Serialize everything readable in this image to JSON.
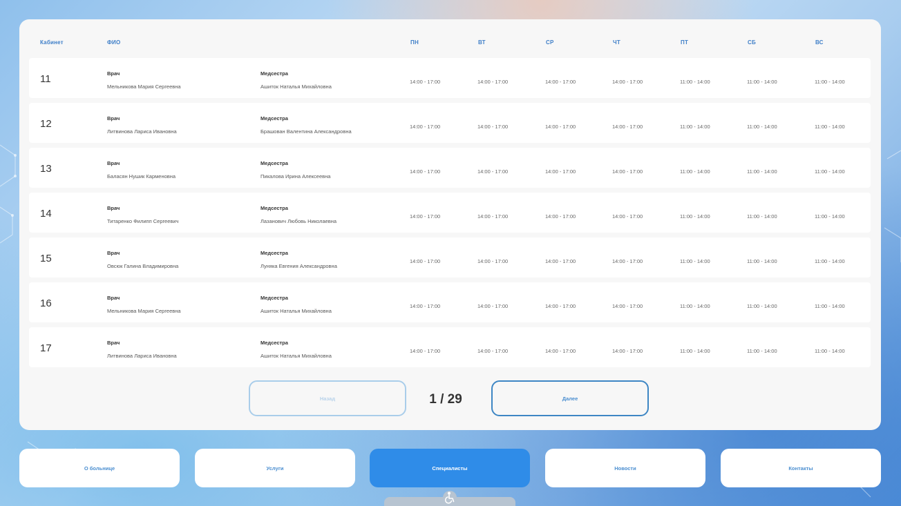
{
  "table": {
    "headers": {
      "cabinet": "Кабинет",
      "fio": "ФИО",
      "days": [
        "ПН",
        "ВТ",
        "СР",
        "ЧТ",
        "ПТ",
        "СБ",
        "ВС"
      ]
    },
    "rows": [
      {
        "cabinet": "11",
        "doctor_role": "Врач",
        "doctor_name": "Мельникова Мария Сергеевна",
        "nurse_role": "Медсестра",
        "nurse_name": "Ашиток Наталья Михайловна",
        "times": [
          "14:00 - 17:00",
          "14:00 - 17:00",
          "14:00 - 17:00",
          "14:00 - 17:00",
          "11:00 - 14:00",
          "11:00 - 14:00",
          "11:00 - 14:00"
        ]
      },
      {
        "cabinet": "12",
        "doctor_role": "Врач",
        "doctor_name": "Литвинова Лариса Ивановна",
        "nurse_role": "Медсестра",
        "nurse_name": "Брашован Валентина Александровна",
        "times": [
          "14:00 - 17:00",
          "14:00 - 17:00",
          "14:00 - 17:00",
          "14:00 - 17:00",
          "11:00 - 14:00",
          "11:00 - 14:00",
          "11:00 - 14:00"
        ]
      },
      {
        "cabinet": "13",
        "doctor_role": "Врач",
        "doctor_name": "Баласян Нушик Карменовна",
        "nurse_role": "Медсестра",
        "nurse_name": "Пикалова Ирина Алексеевна",
        "times": [
          "14:00 - 17:00",
          "14:00 - 17:00",
          "14:00 - 17:00",
          "14:00 - 17:00",
          "11:00 - 14:00",
          "11:00 - 14:00",
          "11:00 - 14:00"
        ]
      },
      {
        "cabinet": "14",
        "doctor_role": "Врач",
        "doctor_name": "Титаренко Филипп Сергеевич",
        "nurse_role": "Медсестра",
        "nurse_name": "Лазанович Любовь Николаевна",
        "times": [
          "14:00 - 17:00",
          "14:00 - 17:00",
          "14:00 - 17:00",
          "14:00 - 17:00",
          "11:00 - 14:00",
          "11:00 - 14:00",
          "11:00 - 14:00"
        ]
      },
      {
        "cabinet": "15",
        "doctor_role": "Врач",
        "doctor_name": "Овсюк Галина Владимировна",
        "nurse_role": "Медсестра",
        "nurse_name": "Луняка Евгения Александровна",
        "times": [
          "14:00 - 17:00",
          "14:00 - 17:00",
          "14:00 - 17:00",
          "14:00 - 17:00",
          "11:00 - 14:00",
          "11:00 - 14:00",
          "11:00 - 14:00"
        ]
      },
      {
        "cabinet": "16",
        "doctor_role": "Врач",
        "doctor_name": "Мельникова Мария Сергеевна",
        "nurse_role": "Медсестра",
        "nurse_name": "Ашиток Наталья Михайловна",
        "times": [
          "14:00 - 17:00",
          "14:00 - 17:00",
          "14:00 - 17:00",
          "14:00 - 17:00",
          "11:00 - 14:00",
          "11:00 - 14:00",
          "11:00 - 14:00"
        ]
      },
      {
        "cabinet": "17",
        "doctor_role": "Врач",
        "doctor_name": "Литвинова Лариса Ивановна",
        "nurse_role": "Медсестра",
        "nurse_name": "Ашиток Наталья Михайловна",
        "times": [
          "14:00 - 17:00",
          "14:00 - 17:00",
          "14:00 - 17:00",
          "14:00 - 17:00",
          "11:00 - 14:00",
          "11:00 - 14:00",
          "11:00 - 14:00"
        ]
      }
    ]
  },
  "pagination": {
    "prev_label": "Назад",
    "next_label": "Далее",
    "current_page": "1",
    "total_pages": "29",
    "indicator": "1 / 29"
  },
  "nav": {
    "items": [
      {
        "label": "О больнице",
        "active": false
      },
      {
        "label": "Услуги",
        "active": false
      },
      {
        "label": "Специалисты",
        "active": true
      },
      {
        "label": "Новости",
        "active": false
      },
      {
        "label": "Контакты",
        "active": false
      }
    ]
  },
  "accessibility": {
    "icon": "wheelchair-icon"
  },
  "colors": {
    "accent": "#2f8ce8",
    "header_text": "#3f7fc8",
    "panel_bg": "#f7f7f7"
  }
}
